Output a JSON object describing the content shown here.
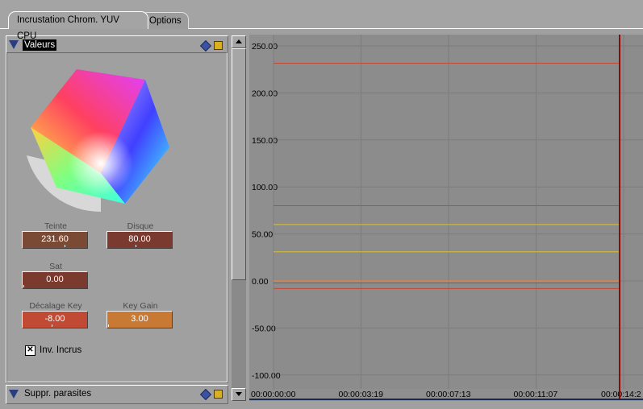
{
  "tabs": [
    {
      "label": "Incrustation Chrom. YUV CPU",
      "active": true
    },
    {
      "label": "Options",
      "active": false
    }
  ],
  "sections": {
    "valeurs": {
      "title": "Valeurs"
    },
    "suppr": {
      "title": "Suppr. parasites"
    }
  },
  "fields": {
    "teinte": {
      "label": "Teinte",
      "value": "231.60",
      "color": "#7a4a34"
    },
    "disque": {
      "label": "Disque",
      "value": "80.00",
      "color": "#7a3a30"
    },
    "sat": {
      "label": "Sat",
      "value": "0.00",
      "color": "#7a3a2e"
    },
    "decalage": {
      "label": "Décalage Key",
      "value": "-8.00",
      "color": "#c04a34"
    },
    "keygain": {
      "label": "Key Gain",
      "value": "3.00",
      "color": "#c87a34"
    }
  },
  "checkbox": {
    "label": "Inv. Incrus",
    "checked": true,
    "mark": "✕"
  },
  "chart_data": {
    "type": "line",
    "y_ticks": [
      "250.00",
      "200.00",
      "150.00",
      "100.00",
      "50.00",
      "0.00",
      "-50.00",
      "-100.00"
    ],
    "x_ticks": [
      "00:00:00:00",
      "00:00:03:19",
      "00:00:07:13",
      "00:00:11:07",
      "00:00:14:2"
    ],
    "ylim": [
      -110,
      260
    ],
    "grid": true,
    "series": [
      {
        "values": [
          231.6
        ],
        "color": "#c04a34"
      },
      {
        "values": [
          80
        ],
        "color": "#c04a34"
      },
      {
        "values": [
          60
        ],
        "color": "#d8c030"
      },
      {
        "values": [
          31
        ],
        "color": "#d8c030"
      },
      {
        "values": [
          0
        ],
        "color": "#ff8030"
      },
      {
        "values": [
          -2
        ],
        "color": "#c04a34"
      },
      {
        "values": [
          -8
        ],
        "color": "#c04a34"
      }
    ],
    "playhead_color": "#8a0a0a"
  }
}
